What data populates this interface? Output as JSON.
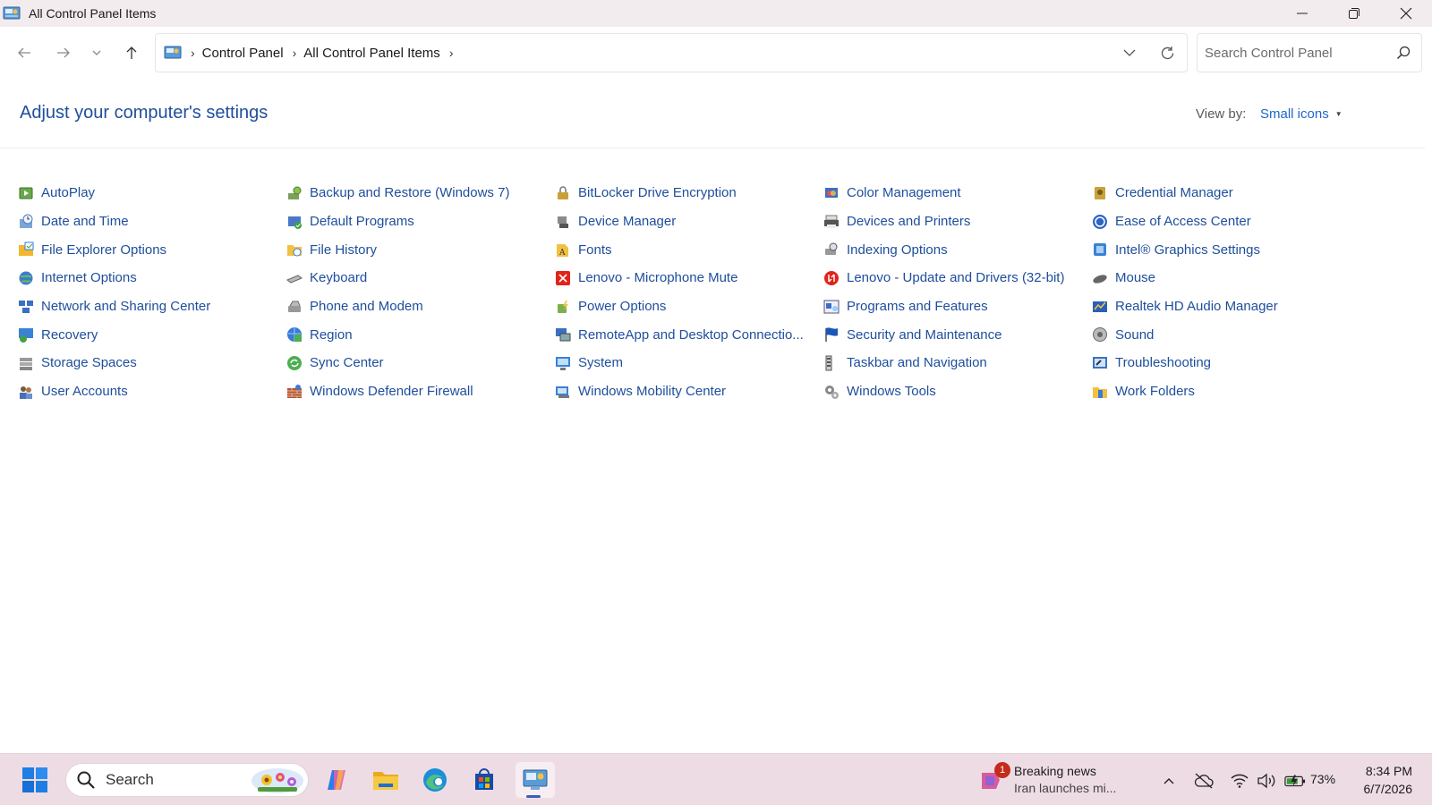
{
  "window": {
    "title": "All Control Panel Items"
  },
  "address": {
    "crumbs": [
      "Control Panel",
      "All Control Panel Items"
    ],
    "search_placeholder": "Search Control Panel"
  },
  "header": {
    "title": "Adjust your computer's settings",
    "view_by_label": "View by:",
    "view_by_value": "Small icons"
  },
  "items": [
    {
      "label": "AutoPlay",
      "icon": "autoplay-icon"
    },
    {
      "label": "Backup and Restore (Windows 7)",
      "icon": "backup-icon"
    },
    {
      "label": "BitLocker Drive Encryption",
      "icon": "bitlocker-icon"
    },
    {
      "label": "Color Management",
      "icon": "color-management-icon"
    },
    {
      "label": "Credential Manager",
      "icon": "credential-icon"
    },
    {
      "label": "Date and Time",
      "icon": "clock-icon"
    },
    {
      "label": "Default Programs",
      "icon": "default-programs-icon"
    },
    {
      "label": "Device Manager",
      "icon": "device-manager-icon"
    },
    {
      "label": "Devices and Printers",
      "icon": "printer-icon"
    },
    {
      "label": "Ease of Access Center",
      "icon": "ease-of-access-icon"
    },
    {
      "label": "File Explorer Options",
      "icon": "folder-options-icon"
    },
    {
      "label": "File History",
      "icon": "file-history-icon"
    },
    {
      "label": "Fonts",
      "icon": "fonts-icon"
    },
    {
      "label": "Indexing Options",
      "icon": "indexing-icon"
    },
    {
      "label": "Intel® Graphics Settings",
      "icon": "intel-graphics-icon"
    },
    {
      "label": "Internet Options",
      "icon": "globe-icon"
    },
    {
      "label": "Keyboard",
      "icon": "keyboard-icon"
    },
    {
      "label": "Lenovo - Microphone Mute",
      "icon": "lenovo-mic-icon"
    },
    {
      "label": "Lenovo - Update and Drivers (32-bit)",
      "icon": "lenovo-update-icon"
    },
    {
      "label": "Mouse",
      "icon": "mouse-icon"
    },
    {
      "label": "Network and Sharing Center",
      "icon": "network-icon"
    },
    {
      "label": "Phone and Modem",
      "icon": "phone-icon"
    },
    {
      "label": "Power Options",
      "icon": "power-icon"
    },
    {
      "label": "Programs and Features",
      "icon": "programs-icon"
    },
    {
      "label": "Realtek HD Audio Manager",
      "icon": "realtek-icon"
    },
    {
      "label": "Recovery",
      "icon": "recovery-icon"
    },
    {
      "label": "Region",
      "icon": "region-icon"
    },
    {
      "label": "RemoteApp and Desktop Connectio...",
      "icon": "remoteapp-icon"
    },
    {
      "label": "Security and Maintenance",
      "icon": "flag-icon"
    },
    {
      "label": "Sound",
      "icon": "speaker-icon"
    },
    {
      "label": "Storage Spaces",
      "icon": "storage-icon"
    },
    {
      "label": "Sync Center",
      "icon": "sync-icon"
    },
    {
      "label": "System",
      "icon": "system-icon"
    },
    {
      "label": "Taskbar and Navigation",
      "icon": "taskbar-icon"
    },
    {
      "label": "Troubleshooting",
      "icon": "troubleshoot-icon"
    },
    {
      "label": "User Accounts",
      "icon": "users-icon"
    },
    {
      "label": "Windows Defender Firewall",
      "icon": "firewall-icon"
    },
    {
      "label": "Windows Mobility Center",
      "icon": "mobility-icon"
    },
    {
      "label": "Windows Tools",
      "icon": "tools-icon"
    },
    {
      "label": "Work Folders",
      "icon": "work-folders-icon"
    }
  ],
  "taskbar": {
    "search_label": "Search",
    "news_badge": "1",
    "news_title": "Breaking news",
    "news_subtitle": "Iran launches mi...",
    "battery_percent": "73%",
    "time": "8:34 PM",
    "date": "6/7/2026"
  },
  "colors": {
    "link": "#1e4e9c",
    "title": "#1e4e9c",
    "titlebar": "#f3ecef",
    "taskbar": "#eedce5"
  }
}
